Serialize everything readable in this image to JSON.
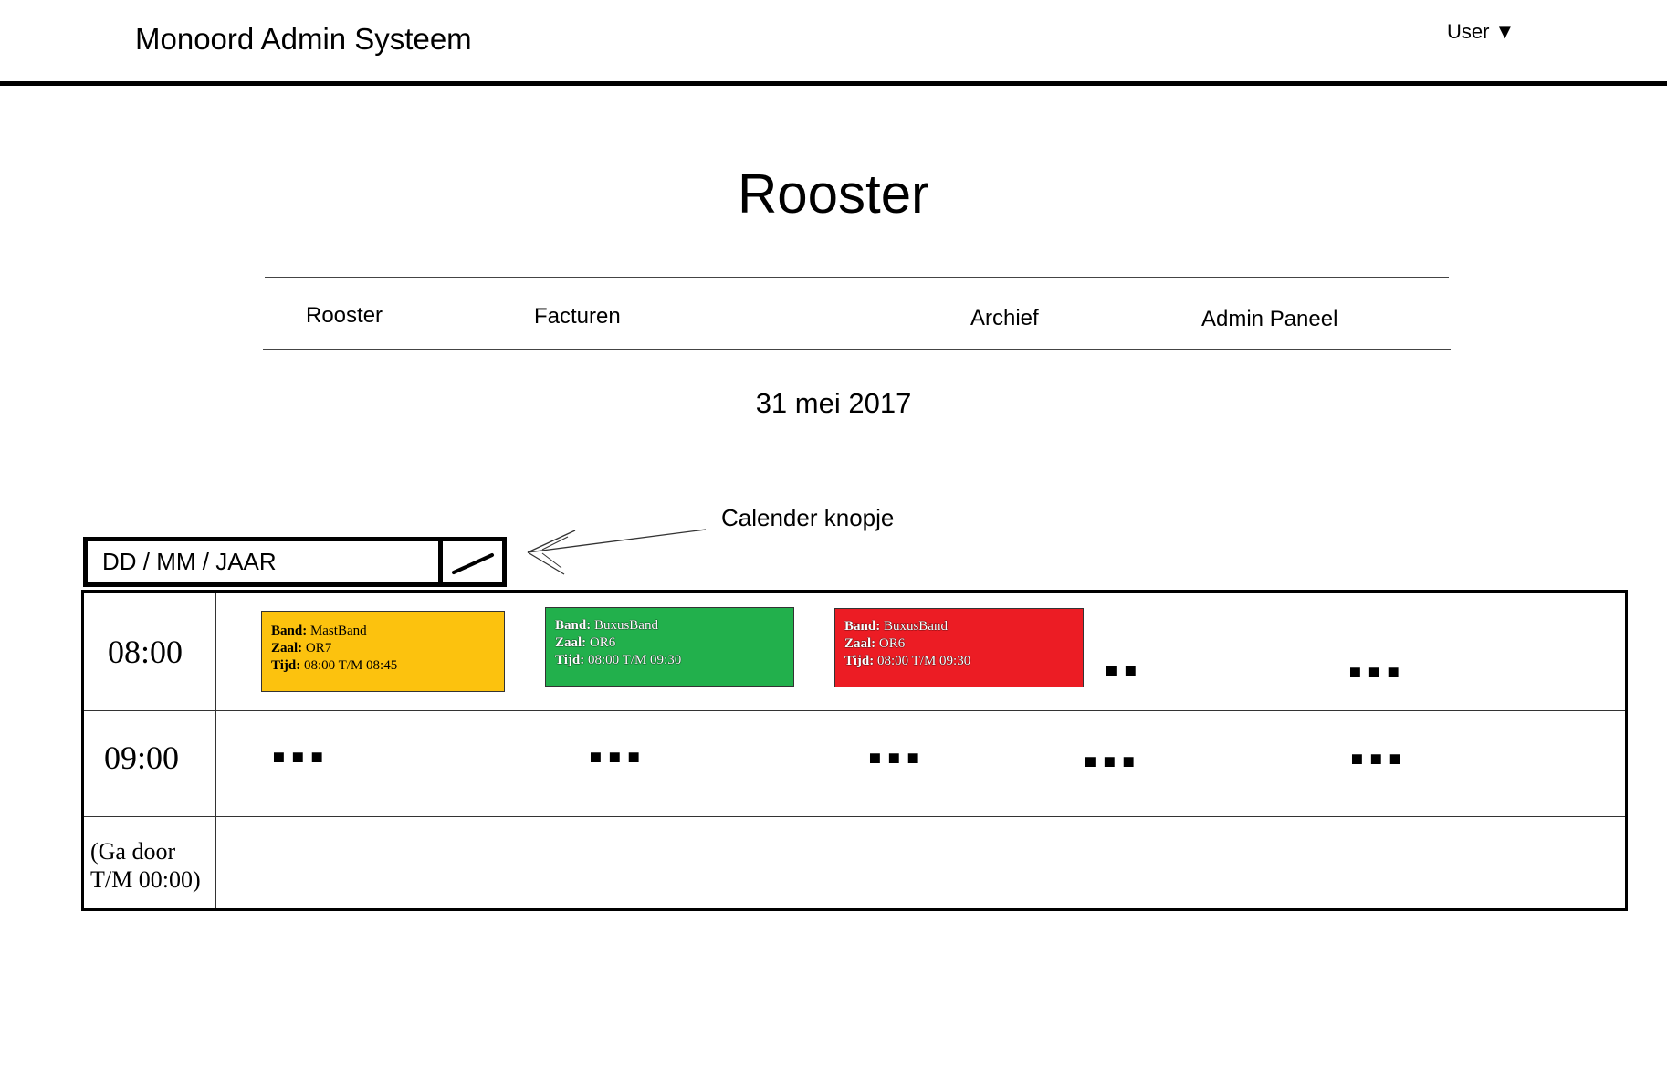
{
  "header": {
    "app_title": "Monoord Admin Systeem",
    "user_label": "User",
    "user_caret": "▼"
  },
  "page": {
    "title": "Rooster"
  },
  "nav": {
    "items": [
      {
        "label": "Rooster"
      },
      {
        "label": "Facturen"
      },
      {
        "label": "Archief"
      },
      {
        "label": "Admin Paneel"
      }
    ]
  },
  "date_display": "31 mei 2017",
  "annotation": "Calender knopje",
  "date_picker": {
    "placeholder": "DD / MM / JAAR",
    "button_icon": "calendar-button-icon"
  },
  "schedule": {
    "times": [
      "08:00",
      "09:00"
    ],
    "continuation_line1": "(Ga door",
    "continuation_line2": "T/M 00:00)",
    "events": [
      {
        "band_label": "Band:",
        "band": "MastBand",
        "zaal_label": "Zaal:",
        "zaal": "OR7",
        "tijd_label": "Tijd:",
        "tijd": "08:00 T/M 08:45",
        "color": "#fcc20e"
      },
      {
        "band_label": "Band:",
        "band": "BuxusBand",
        "zaal_label": "Zaal:",
        "zaal": "OR6",
        "tijd_label": "Tijd:",
        "tijd": "08:00 T/M 09:30",
        "color": "#22b04c"
      },
      {
        "band_label": "Band:",
        "band": "BuxusBand",
        "zaal_label": "Zaal:",
        "zaal": "OR6",
        "tijd_label": "Tijd:",
        "tijd": "08:00 T/M 09:30",
        "color": "#ec1c24"
      }
    ],
    "ellipsis_short": "▪▪",
    "ellipsis": "▪▪▪"
  }
}
